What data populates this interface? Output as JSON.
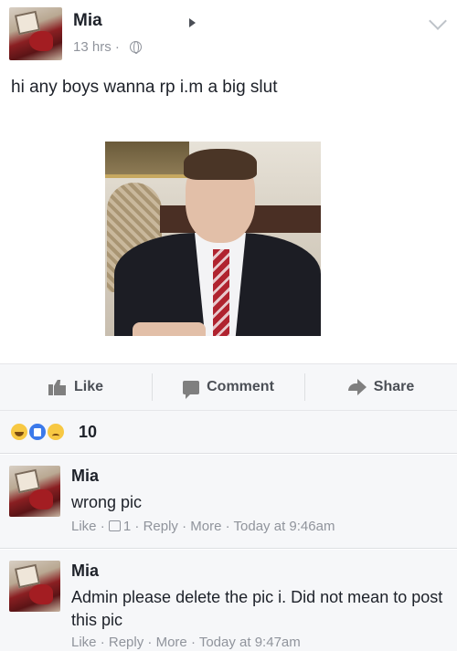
{
  "post": {
    "author": "Mia",
    "time": "13 hrs ·",
    "text": "hi any boys wanna rp i.m a big slut"
  },
  "actions": {
    "like": "Like",
    "comment": "Comment",
    "share": "Share"
  },
  "reactions": {
    "icons": [
      "haha-icon",
      "like-icon",
      "sad-icon"
    ],
    "count": "10"
  },
  "comments": [
    {
      "author": "Mia",
      "text": "wrong pic",
      "like": "Like",
      "like_count": "1",
      "reply": "Reply",
      "more": "More",
      "time": "Today at 9:46am"
    },
    {
      "author": "Mia",
      "text": "Admin please delete the pic i. Did not mean to post this pic",
      "like": "Like",
      "reply": "Reply",
      "more": "More",
      "time": "Today at 9:47am"
    }
  ],
  "colors": {
    "text": "#1d2129",
    "meta": "#90949c",
    "bar_bg": "#f6f7f9",
    "action": "#4b4f56"
  }
}
